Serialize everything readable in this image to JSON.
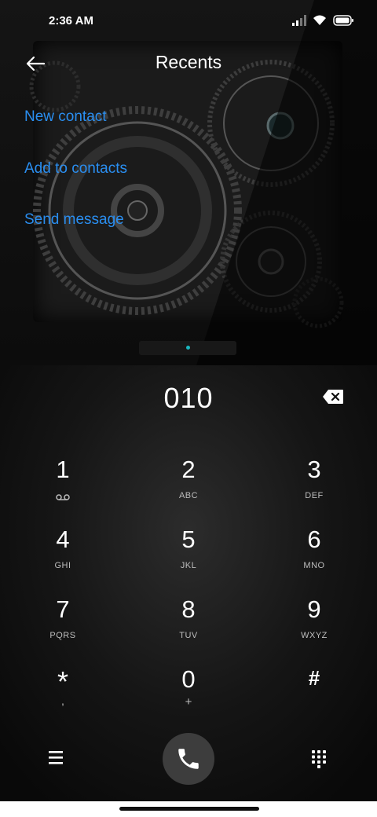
{
  "status_bar": {
    "time": "2:36 AM",
    "icons": [
      "signal-icon",
      "wifi-icon",
      "battery-icon"
    ]
  },
  "header": {
    "title": "Recents",
    "back_icon": "back-arrow-icon"
  },
  "actions": [
    {
      "label": "New contact"
    },
    {
      "label": "Add to contacts"
    },
    {
      "label": "Send message"
    }
  ],
  "dialer": {
    "number": "010",
    "backspace_icon": "backspace-icon",
    "keys": [
      {
        "digit": "1",
        "sub": "",
        "sub_icon": "voicemail-icon"
      },
      {
        "digit": "2",
        "sub": "ABC"
      },
      {
        "digit": "3",
        "sub": "DEF"
      },
      {
        "digit": "4",
        "sub": "GHI"
      },
      {
        "digit": "5",
        "sub": "JKL"
      },
      {
        "digit": "6",
        "sub": "MNO"
      },
      {
        "digit": "7",
        "sub": "PQRS"
      },
      {
        "digit": "8",
        "sub": "TUV"
      },
      {
        "digit": "9",
        "sub": "WXYZ"
      },
      {
        "digit": "*",
        "sub": ","
      },
      {
        "digit": "0",
        "sub": "+"
      },
      {
        "digit": "#",
        "sub": ""
      }
    ]
  },
  "bottom_bar": {
    "menu_icon": "menu-icon",
    "call_icon": "phone-icon",
    "keypad_icon": "dialpad-icon"
  },
  "colors": {
    "link": "#2a8ef0",
    "call_button": "#3d3d3d",
    "accent_dot": "#1ab6c0"
  }
}
